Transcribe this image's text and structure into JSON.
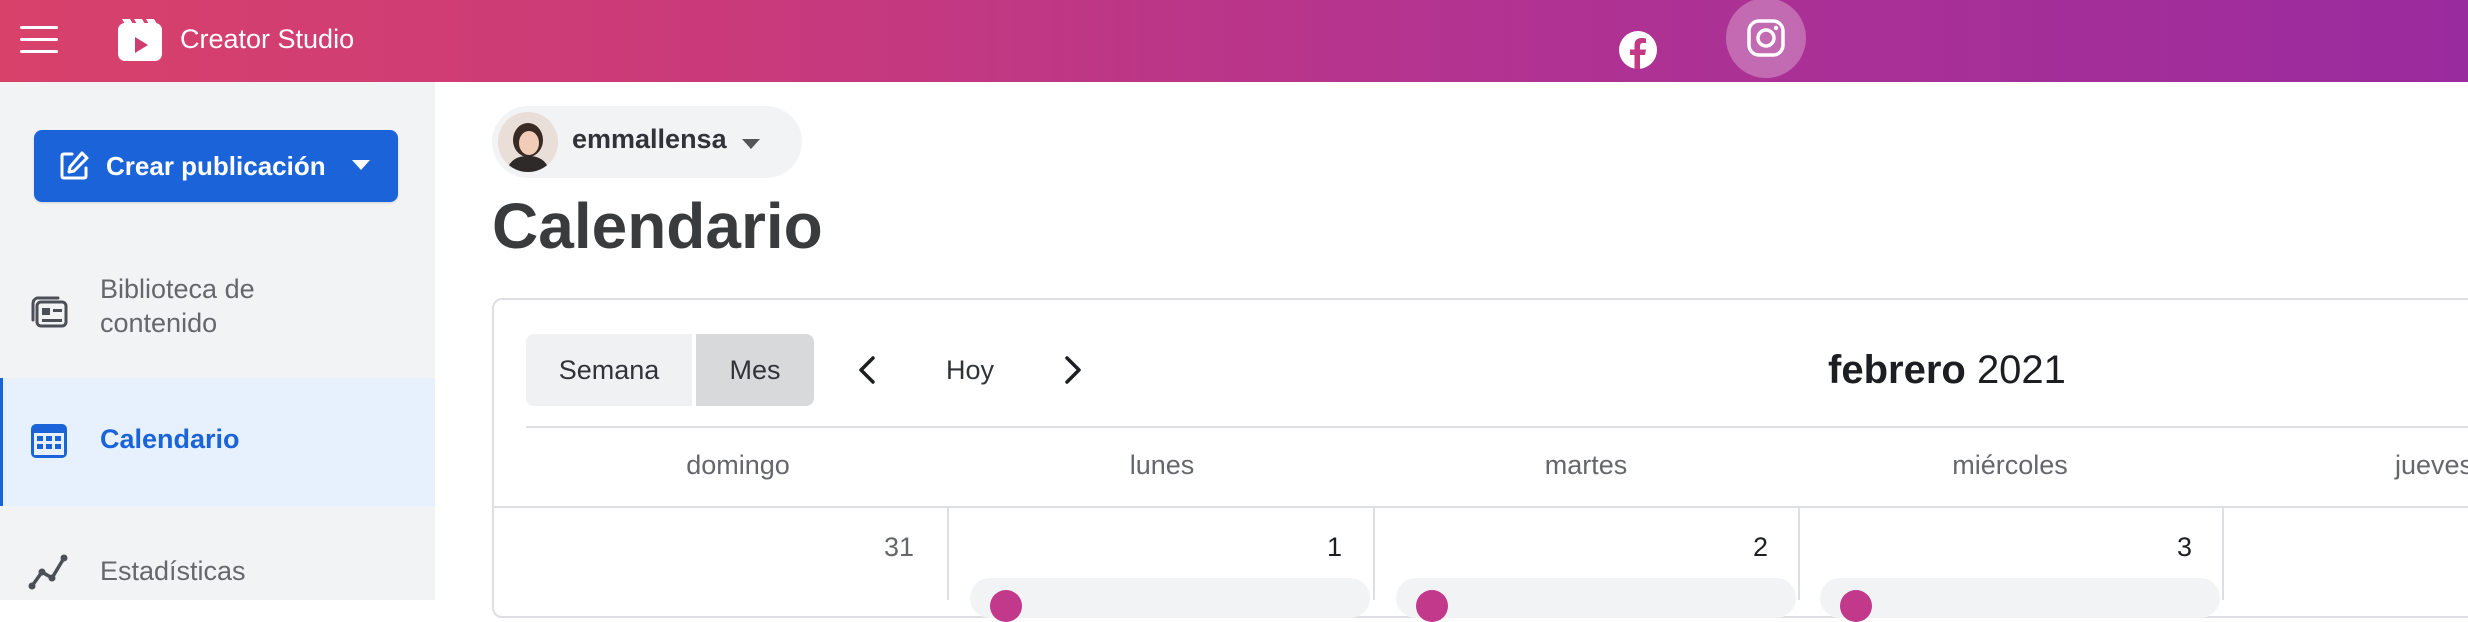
{
  "topbar": {
    "app_title": "Creator Studio",
    "icons": [
      "menu-icon",
      "creator-studio-logo",
      "facebook-icon",
      "instagram-icon"
    ],
    "gradient": [
      "#d8416a",
      "#9a2b9e"
    ]
  },
  "sidebar": {
    "create_button_label": "Crear publicación",
    "items": [
      {
        "label": "Biblioteca de contenido",
        "line1": "Biblioteca de",
        "line2": "contenido",
        "icon": "library-icon"
      },
      {
        "label": "Calendario",
        "icon": "calendar-icon",
        "active": true
      },
      {
        "label": "Estadísticas",
        "icon": "stats-icon"
      }
    ]
  },
  "main": {
    "account_name": "emmallensa",
    "page_title": "Calendario",
    "view_toggle": {
      "week": "Semana",
      "month": "Mes",
      "selected": "Mes"
    },
    "today_label": "Hoy",
    "month": "febrero",
    "year": "2021",
    "weekdays": [
      "domingo",
      "lunes",
      "martes",
      "miércoles",
      "jueves"
    ],
    "days": [
      "31",
      "1",
      "2",
      "3"
    ]
  },
  "colors": {
    "accent": "#1b63d9",
    "instagram": "#c2388a"
  }
}
